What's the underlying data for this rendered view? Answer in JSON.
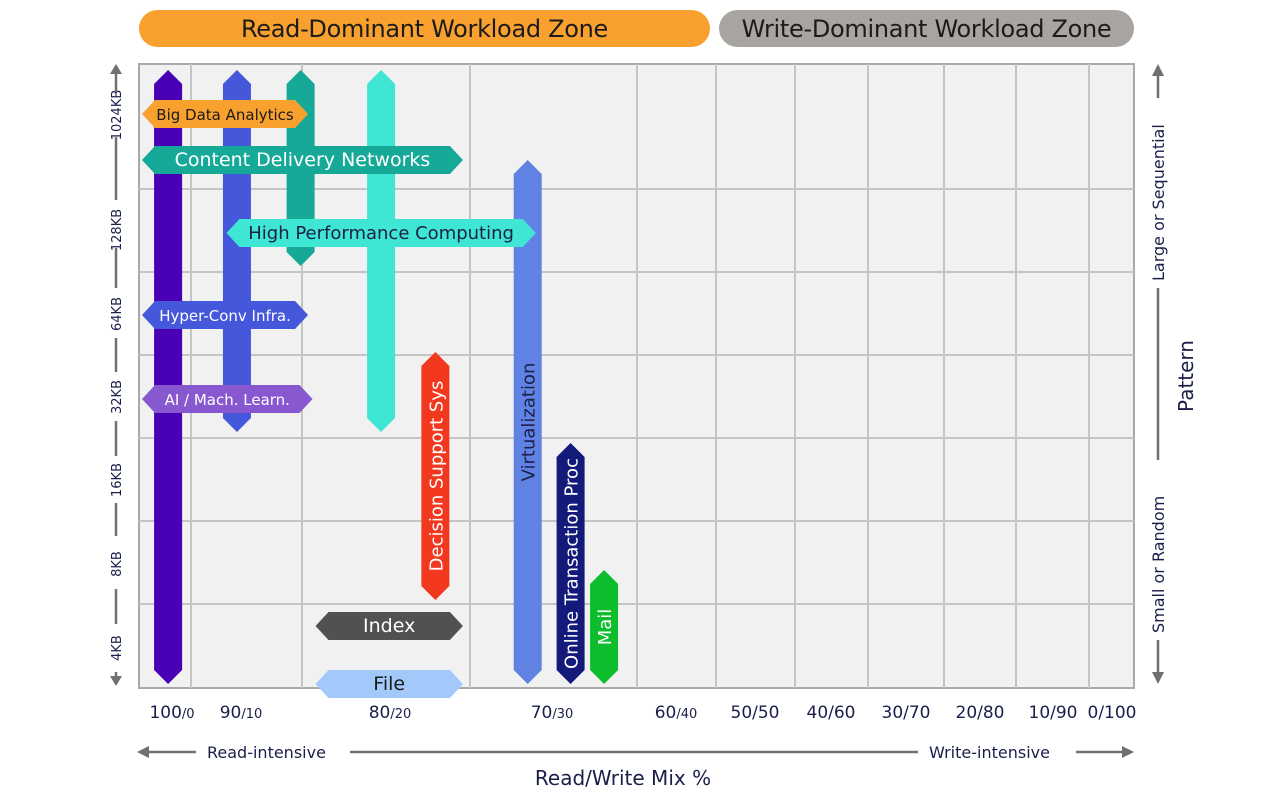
{
  "zones": {
    "read": {
      "label": "Read-Dominant Workload Zone",
      "color": "#f9a12e"
    },
    "write": {
      "label": "Write-Dominant Workload Zone",
      "color": "#a8a4a0"
    }
  },
  "chart_data": {
    "type": "range-arrows",
    "title": "",
    "xlabel": "Read/Write Mix %",
    "ylabel": "Pattern",
    "x_direction_labels": {
      "left": "Read-intensive",
      "right": "Write-intensive"
    },
    "y_direction_labels": {
      "top": "Large or Sequential",
      "bottom": "Small or Random"
    },
    "x_ticks": [
      {
        "major": "100",
        "minor": "/0"
      },
      {
        "major": "90",
        "minor": "/10"
      },
      {
        "major": "80",
        "minor": "/20"
      },
      {
        "major": "70",
        "minor": "/30"
      },
      {
        "major": "60",
        "minor": "/40"
      },
      {
        "major": "50/50",
        "minor": ""
      },
      {
        "major": "40/60",
        "minor": ""
      },
      {
        "major": "30/70",
        "minor": ""
      },
      {
        "major": "20/80",
        "minor": ""
      },
      {
        "major": "10/90",
        "minor": ""
      },
      {
        "major": "0/100",
        "minor": ""
      }
    ],
    "y_ticks": [
      "4KB",
      "8KB",
      "16KB",
      "32KB",
      "64KB",
      "128KB",
      "1024KB"
    ],
    "grid": true,
    "vertical_bars": [
      {
        "name": "Bar 100/0 full range",
        "label": "",
        "read_pct": 99,
        "from": "4KB",
        "to": "top",
        "color": "#4a00b4",
        "text_color": "#ffffff"
      },
      {
        "name": "Bar 90/10",
        "label": "",
        "read_pct": 90.5,
        "from": "32KB-",
        "to": "top",
        "color": "#4557da",
        "text_color": "#ffffff"
      },
      {
        "name": "Bar ~86/14",
        "label": "",
        "read_pct": 86,
        "from": "128KB",
        "to": "top",
        "color": "#16a998",
        "text_color": "#ffffff"
      },
      {
        "name": "Bar ~81/19",
        "label": "",
        "read_pct": 80.6,
        "from": "32KB-",
        "to": "top",
        "color": "#3fe6d4",
        "text_color": "#ffffff"
      },
      {
        "name": "Decision Support Sys",
        "label": "Decision Support Sys",
        "read_pct": 77.2,
        "from": "6KB",
        "to": "40KB",
        "color": "#f2381e",
        "text_color": "#ffffff"
      },
      {
        "name": "Virtualization",
        "label": "Virtualization",
        "read_pct": 71.5,
        "from": "4KB",
        "to": "512KB",
        "color": "#6083e3",
        "text_color": "#1a1f4a"
      },
      {
        "name": "Online Transaction Proc",
        "label": "Online Transaction Proc",
        "read_pct": 68.5,
        "from": "4KB",
        "to": "16KB+",
        "color": "#141a7a",
        "text_color": "#ffffff"
      },
      {
        "name": "Mail",
        "label": "Mail",
        "read_pct": 65.8,
        "from": "4KB",
        "to": "8KB-",
        "color": "#0dbd2c",
        "text_color": "#ffffff"
      }
    ],
    "horizontal_bars": [
      {
        "name": "Big Data Analytics",
        "label": "Big Data Analytics",
        "size": "1024KB",
        "read_from": 100,
        "read_to": 85.5,
        "color": "#f9a12e",
        "text_color": "#1b1b1b"
      },
      {
        "name": "Content Delivery Networks",
        "label": "Content Delivery Networks",
        "size": "512KB",
        "read_from": 100,
        "read_to": 75.5,
        "color": "#16a998",
        "text_color": "#ffffff"
      },
      {
        "name": "High Performance Computing",
        "label": "High Performance Computing",
        "size": "128KB+",
        "read_from": 91.8,
        "read_to": 71,
        "color": "#3fe6d4",
        "text_color": "#1a1f4a"
      },
      {
        "name": "Hyper-Conv Infra.",
        "label": "Hyper-Conv Infra.",
        "size": "64KB",
        "read_from": 100,
        "read_to": 85.5,
        "color": "#4557da",
        "text_color": "#ffffff"
      },
      {
        "name": "AI / Mach. Learn.",
        "label": "AI / Mach. Learn.",
        "size": "32KB",
        "read_from": 100,
        "read_to": 85.2,
        "color": "#8758cf",
        "text_color": "#ffffff"
      },
      {
        "name": "Index",
        "label": "Index",
        "size": "4KB+",
        "read_from": 85,
        "read_to": 75.5,
        "color": "#515150",
        "text_color": "#ffffff"
      },
      {
        "name": "File",
        "label": "File",
        "size": "4KB",
        "read_from": 85,
        "read_to": 75.5,
        "color": "#a2c9fa",
        "text_color": "#1b1b1b"
      }
    ]
  }
}
